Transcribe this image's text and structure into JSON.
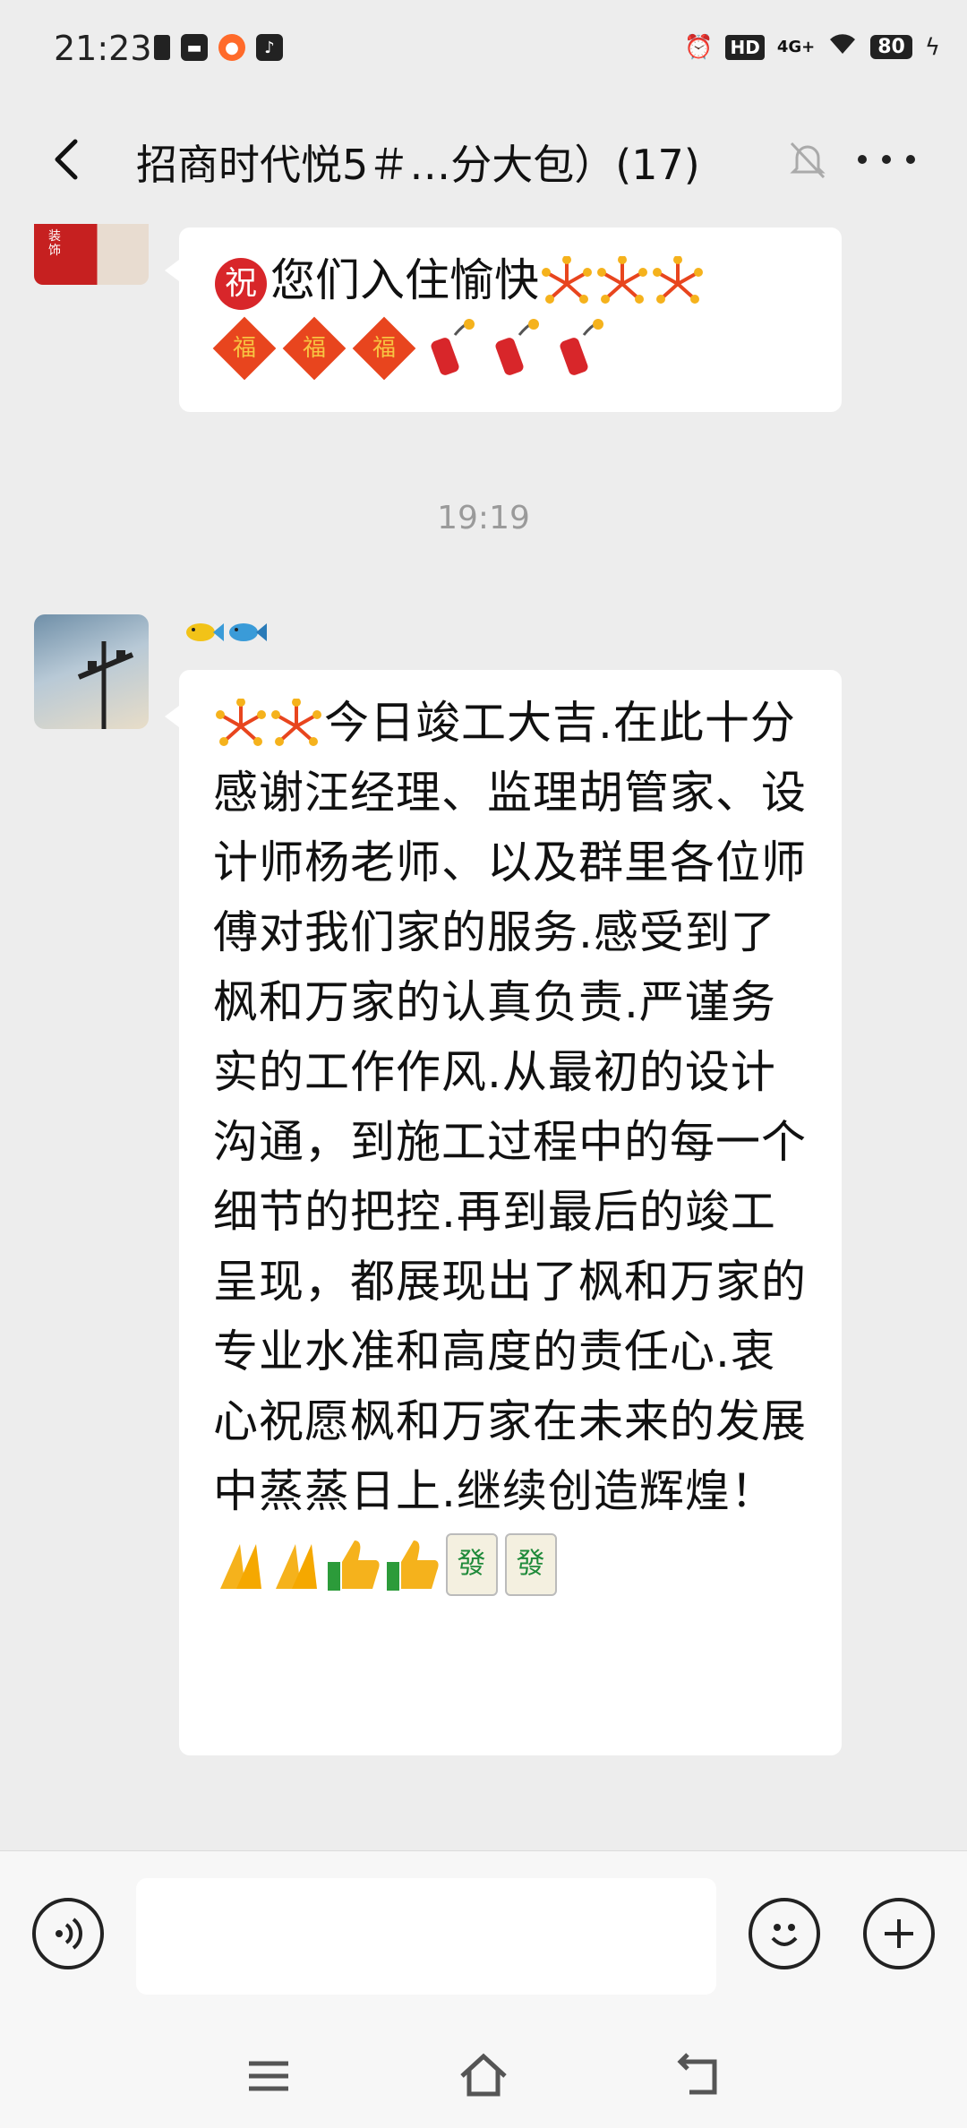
{
  "status": {
    "time": "21:23",
    "hd": "HD",
    "network": "4G+",
    "battery": "80"
  },
  "header": {
    "title": "招商时代悦5＃…分大包）(17)"
  },
  "messages": [
    {
      "text": "您们入住愉快"
    },
    {
      "time": "19:19"
    },
    {
      "text": "今日竣工大吉.在此十分感谢汪经理、监理胡管家、设计师杨老师、以及群里各位师傅对我们家的服务.感受到了枫和万家的认真负责.严谨务实的工作作风.从最初的设计沟通，到施工过程中的每一个细节的把控.再到最后的竣工呈现，都展现出了枫和万家的专业水准和高度的责任心.衷心祝愿枫和万家在未来的发展中蒸蒸日上.继续创造辉煌！"
    }
  ],
  "colors": {
    "background": "#ededed",
    "bubble": "#ffffff",
    "timestamp": "#9a9a9a"
  },
  "icons": [
    "back-arrow-icon",
    "mute-bell-icon",
    "more-dots-icon",
    "voice-icon",
    "emoji-icon",
    "plus-icon",
    "menu-icon",
    "home-icon",
    "back-icon"
  ]
}
